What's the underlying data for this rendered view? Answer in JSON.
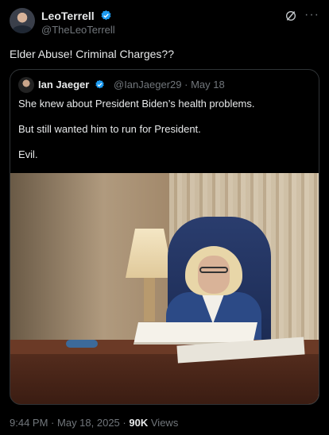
{
  "author": {
    "name": "LeoTerrell",
    "handle": "@TheLeoTerrell",
    "verified_color": "#1d9bf0"
  },
  "tweet": {
    "text": "Elder Abuse! Criminal Charges??"
  },
  "quoted": {
    "name": "Ian Jaeger",
    "handle": "@IanJaeger29",
    "separator": "·",
    "date": "May 18",
    "lines": [
      "She knew about President Biden’s health problems.",
      "But still wanted him to run for President.",
      "Evil."
    ]
  },
  "meta": {
    "time": "9:44 PM",
    "date": "May 18, 2025",
    "views_count": "90K",
    "views_label": "Views",
    "separator": "·"
  },
  "icons": {
    "grok": "grok-icon",
    "more": "more-icon",
    "verified": "verified-badge-icon"
  },
  "colors": {
    "background": "#000000",
    "text": "#e7e9ea",
    "secondary": "#71767b",
    "border": "#2f3336"
  }
}
